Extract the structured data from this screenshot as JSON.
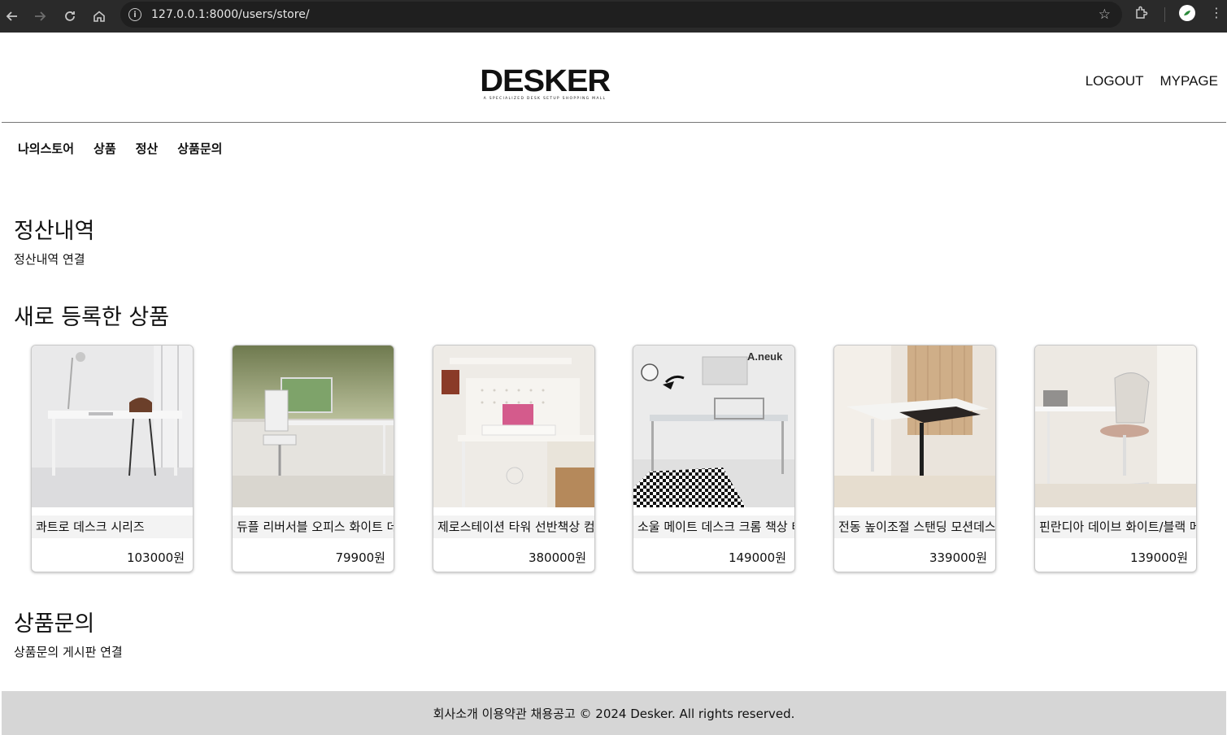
{
  "browser": {
    "url": "127.0.0.1:8000/users/store/",
    "back_icon": "arrow-left-icon",
    "forward_icon": "arrow-right-icon",
    "reload_icon": "reload-icon",
    "home_icon": "home-icon",
    "bookmark_icon": "star-icon",
    "extensions_icon": "puzzle-icon",
    "menu_icon": "kebab-menu-icon"
  },
  "header": {
    "logo_text": "DESKER",
    "logo_tagline": "A SPECIALIZED DESK SETUP SHOPPING MALL",
    "links": [
      "LOGOUT",
      "MYPAGE"
    ]
  },
  "subnav": {
    "items": [
      "나의스토어",
      "상품",
      "정산",
      "상품문의"
    ]
  },
  "settlement": {
    "title": "정산내역",
    "text": "정산내역 연결"
  },
  "new_products": {
    "title": "새로 등록한 상품",
    "items": [
      {
        "name": "콰트로 데스크 시리즈",
        "price": "103000원"
      },
      {
        "name": "듀플 리버서블 오피스 화이트 데스크",
        "price": "79900원"
      },
      {
        "name": "제로스테이션 타워 선반책상 컴퓨터",
        "price": "380000원"
      },
      {
        "name": "소울 메이트 데스크 크롬 책상 테이블",
        "price": "149000원"
      },
      {
        "name": "전동 높이조절 스탠딩 모션데스크",
        "price": "339000원"
      },
      {
        "name": "핀란디아 데이브 화이트/블랙 메쉬의자",
        "price": "139000원"
      }
    ]
  },
  "inquiry": {
    "title": "상품문의",
    "text": "상품문의 게시판 연결"
  },
  "footer": {
    "text": "회사소개 이용약관 채용공고 © 2024 Desker. All rights reserved."
  },
  "colors": {
    "chrome_bg": "#2a2a2a",
    "footer_bg": "#d6d6d6",
    "card_name_bg": "#f3f3f3"
  }
}
